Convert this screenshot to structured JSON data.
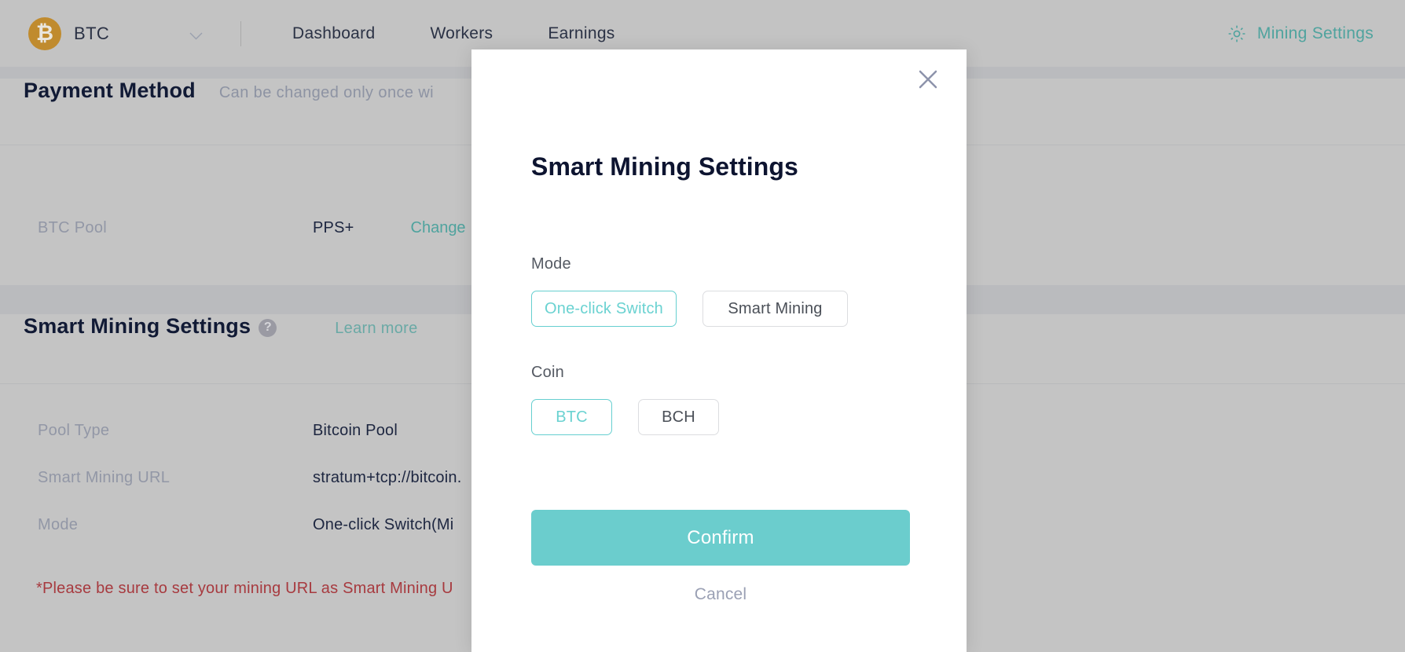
{
  "header": {
    "coin_logo_glyph": "₿",
    "coin": "BTC",
    "nav": [
      {
        "label": "Dashboard"
      },
      {
        "label": "Workers"
      },
      {
        "label": "Earnings"
      }
    ],
    "settings_link": "Mining Settings"
  },
  "payment_section": {
    "title": "Payment Method",
    "note": "Can be changed only once wi",
    "rows": [
      {
        "key": "BTC Pool",
        "value": "PPS+",
        "action": "Change"
      }
    ]
  },
  "smart_section": {
    "title": "Smart Mining Settings",
    "help_glyph": "?",
    "learn_more": "Learn more",
    "rows": [
      {
        "key": "Pool Type",
        "value": "Bitcoin Pool",
        "extra": ""
      },
      {
        "key": "Smart Mining URL",
        "value": "stratum+tcp://bitcoin.",
        "extra": ""
      },
      {
        "key": "Mode",
        "value": "One-click Switch ",
        "extra": "(Mi"
      }
    ],
    "warning": "*Please be sure to set your mining URL as Smart Mining U"
  },
  "modal": {
    "title": "Smart Mining Settings",
    "close_glyph": "✕",
    "mode": {
      "label": "Mode",
      "options": [
        {
          "label": "One-click Switch",
          "selected": true
        },
        {
          "label": "Smart Mining",
          "selected": false
        }
      ]
    },
    "coin": {
      "label": "Coin",
      "options": [
        {
          "label": "BTC",
          "selected": true
        },
        {
          "label": "BCH",
          "selected": false
        }
      ]
    },
    "confirm_label": "Confirm",
    "cancel_label": "Cancel"
  },
  "colors": {
    "accent_teal": "#6bcdcd",
    "link_teal": "#4fa39e",
    "warning_red": "#a73a3f",
    "orange": "#d79a46",
    "btc_gold": "#c08b2e",
    "page_bg": "#c3c3c3"
  }
}
